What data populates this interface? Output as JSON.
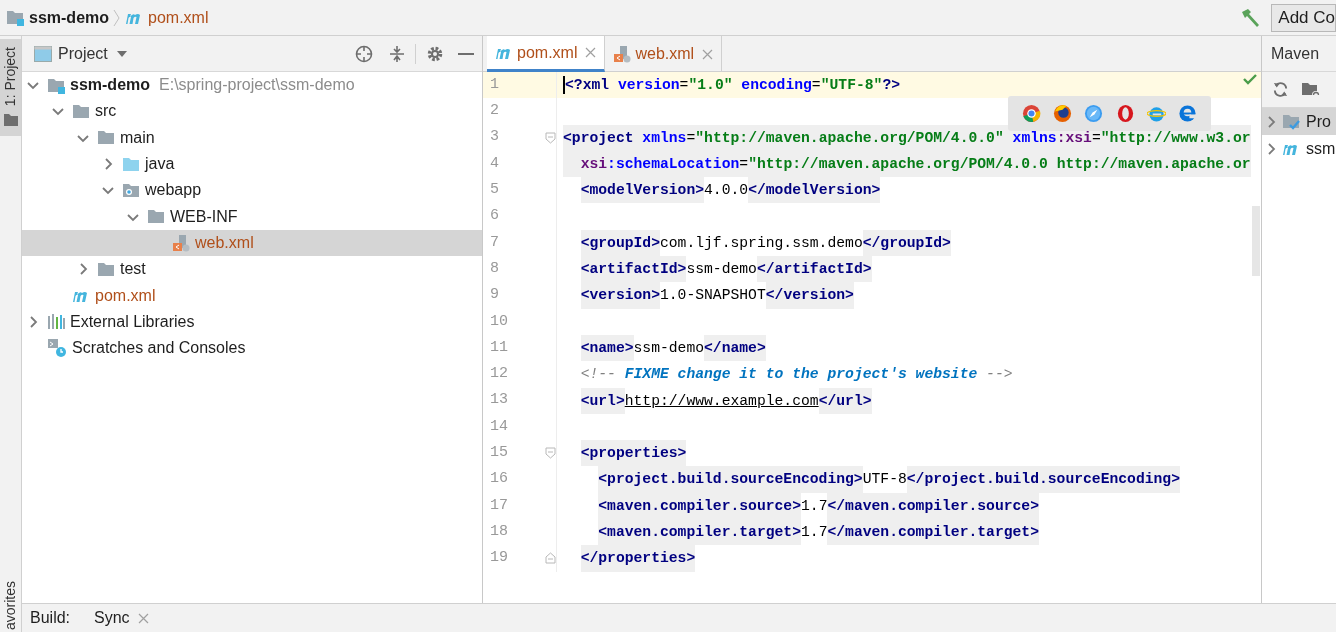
{
  "breadcrumb": [
    {
      "kind": "module",
      "label": "ssm-demo"
    },
    {
      "kind": "maven",
      "label": "pom.xml"
    }
  ],
  "toolbar": {
    "button": "Add Co"
  },
  "side_tabs": [
    {
      "label": "1: Project",
      "selected": true
    },
    {
      "label": "avorites",
      "selected": false
    }
  ],
  "project_panel": {
    "title": "Project",
    "tree": [
      {
        "kind": "module",
        "label": "ssm-demo",
        "path": "E:\\spring-project\\ssm-demo",
        "expanded": true,
        "selected": false,
        "children": [
          {
            "kind": "folder",
            "label": "src",
            "expanded": true,
            "selected": false,
            "children": [
              {
                "kind": "folder",
                "label": "main",
                "expanded": true,
                "selected": false,
                "children": [
                  {
                    "kind": "source-folder",
                    "label": "java",
                    "expanded": false,
                    "selected": false
                  },
                  {
                    "kind": "web-folder",
                    "label": "webapp",
                    "expanded": true,
                    "selected": false,
                    "children": [
                      {
                        "kind": "folder",
                        "label": "WEB-INF",
                        "expanded": true,
                        "selected": false,
                        "children": [
                          {
                            "kind": "web-xml",
                            "label": "web.xml",
                            "selected": true
                          }
                        ]
                      }
                    ]
                  }
                ]
              },
              {
                "kind": "folder",
                "label": "test",
                "expanded": false,
                "selected": false
              }
            ]
          },
          {
            "kind": "maven",
            "label": "pom.xml",
            "selected": false
          }
        ]
      },
      {
        "kind": "libraries",
        "label": "External Libraries",
        "expanded": false,
        "selected": false
      },
      {
        "kind": "scratches",
        "label": "Scratches and Consoles",
        "selected": false
      }
    ]
  },
  "editor_tabs": [
    {
      "kind": "maven",
      "label": "pom.xml",
      "selected": true
    },
    {
      "kind": "web-xml",
      "label": "web.xml",
      "selected": false
    }
  ],
  "code_lines": [
    {
      "number": "1",
      "current": true,
      "tokens": [
        {
          "kind": "pi",
          "text": "<?xml"
        },
        {
          "kind": "attr",
          "text": " version"
        },
        {
          "kind": "plain",
          "text": "="
        },
        {
          "kind": "string",
          "text": "\"1.0\""
        },
        {
          "kind": "attr",
          "text": " encoding"
        },
        {
          "kind": "plain",
          "text": "="
        },
        {
          "kind": "string",
          "text": "\"UTF-8\""
        },
        {
          "kind": "pi",
          "text": "?>"
        }
      ]
    },
    {
      "number": "2"
    },
    {
      "number": "3",
      "fold_start": true,
      "shaded": true,
      "tokens": [
        {
          "kind": "tag",
          "text": "<project"
        },
        {
          "kind": "attr",
          "text": " xmlns"
        },
        {
          "kind": "plain",
          "text": "="
        },
        {
          "kind": "string",
          "text": "\"http://maven.apache.org/POM/4.0.0\""
        },
        {
          "kind": "attr",
          "text": " xmlns"
        },
        {
          "kind": "ns",
          "text": ":xsi"
        },
        {
          "kind": "plain",
          "text": "="
        },
        {
          "kind": "string",
          "text": "\"http://www.w3.or"
        }
      ]
    },
    {
      "number": "4",
      "shaded": true,
      "tokens": [
        {
          "kind": "ns",
          "text": "  xsi"
        },
        {
          "kind": "attr",
          "text": ":schemaLocation"
        },
        {
          "kind": "plain",
          "text": "="
        },
        {
          "kind": "string",
          "text": "\"http://maven.apache.org/POM/4.0.0 http://maven.apache.or"
        }
      ]
    },
    {
      "number": "5",
      "tokens": [
        {
          "kind": "tag",
          "text": "  <modelVersion>"
        },
        {
          "kind": "plain",
          "text": "4.0.0"
        },
        {
          "kind": "tag",
          "text": "</modelVersion>"
        }
      ]
    },
    {
      "number": "6"
    },
    {
      "number": "7",
      "tokens": [
        {
          "kind": "tag",
          "text": "  <groupId>"
        },
        {
          "kind": "plain",
          "text": "com.ljf.spring.ssm.demo"
        },
        {
          "kind": "tag",
          "text": "</groupId>"
        }
      ]
    },
    {
      "number": "8",
      "tokens": [
        {
          "kind": "tag",
          "text": "  <artifactId>"
        },
        {
          "kind": "plain",
          "text": "ssm-demo"
        },
        {
          "kind": "tag",
          "text": "</artifactId>"
        }
      ]
    },
    {
      "number": "9",
      "tokens": [
        {
          "kind": "tag",
          "text": "  <version>"
        },
        {
          "kind": "plain",
          "text": "1.0-SNAPSHOT"
        },
        {
          "kind": "tag",
          "text": "</version>"
        }
      ]
    },
    {
      "number": "10"
    },
    {
      "number": "11",
      "tokens": [
        {
          "kind": "tag",
          "text": "  <name>"
        },
        {
          "kind": "plain",
          "text": "ssm-demo"
        },
        {
          "kind": "tag",
          "text": "</name>"
        }
      ]
    },
    {
      "number": "12",
      "tokens": [
        {
          "kind": "comment",
          "text": "  <!-- "
        },
        {
          "kind": "todo",
          "text": "FIXME change it to the project's website"
        },
        {
          "kind": "comment",
          "text": " -->"
        }
      ]
    },
    {
      "number": "13",
      "tokens": [
        {
          "kind": "tag",
          "text": "  <url>"
        },
        {
          "kind": "link",
          "text": "http://www.example.com"
        },
        {
          "kind": "tag",
          "text": "</url>"
        }
      ]
    },
    {
      "number": "14"
    },
    {
      "number": "15",
      "fold_start": true,
      "tokens": [
        {
          "kind": "tag",
          "text": "  <properties>"
        }
      ]
    },
    {
      "number": "16",
      "tokens": [
        {
          "kind": "tag",
          "text": "    <project.build.sourceEncoding>"
        },
        {
          "kind": "plain",
          "text": "UTF-8"
        },
        {
          "kind": "tag",
          "text": "</project.build.sourceEncoding>"
        }
      ]
    },
    {
      "number": "17",
      "tokens": [
        {
          "kind": "tag",
          "text": "    <maven.compiler.source>"
        },
        {
          "kind": "plain",
          "text": "1.7"
        },
        {
          "kind": "tag",
          "text": "</maven.compiler.source>"
        }
      ]
    },
    {
      "number": "18",
      "tokens": [
        {
          "kind": "tag",
          "text": "    <maven.compiler.target>"
        },
        {
          "kind": "plain",
          "text": "1.7"
        },
        {
          "kind": "tag",
          "text": "</maven.compiler.target>"
        }
      ]
    },
    {
      "number": "19",
      "fold_end": true,
      "tokens": [
        {
          "kind": "tag",
          "text": "  </properties>"
        }
      ]
    }
  ],
  "maven_panel": {
    "title": "Maven",
    "tree": [
      {
        "kind": "maven-projects",
        "label": "Pro",
        "selected": true
      },
      {
        "kind": "maven",
        "label": "ssm",
        "selected": false
      }
    ]
  },
  "bottom_bar": {
    "label": "Build:",
    "tabs": [
      {
        "label": "Sync"
      }
    ]
  }
}
